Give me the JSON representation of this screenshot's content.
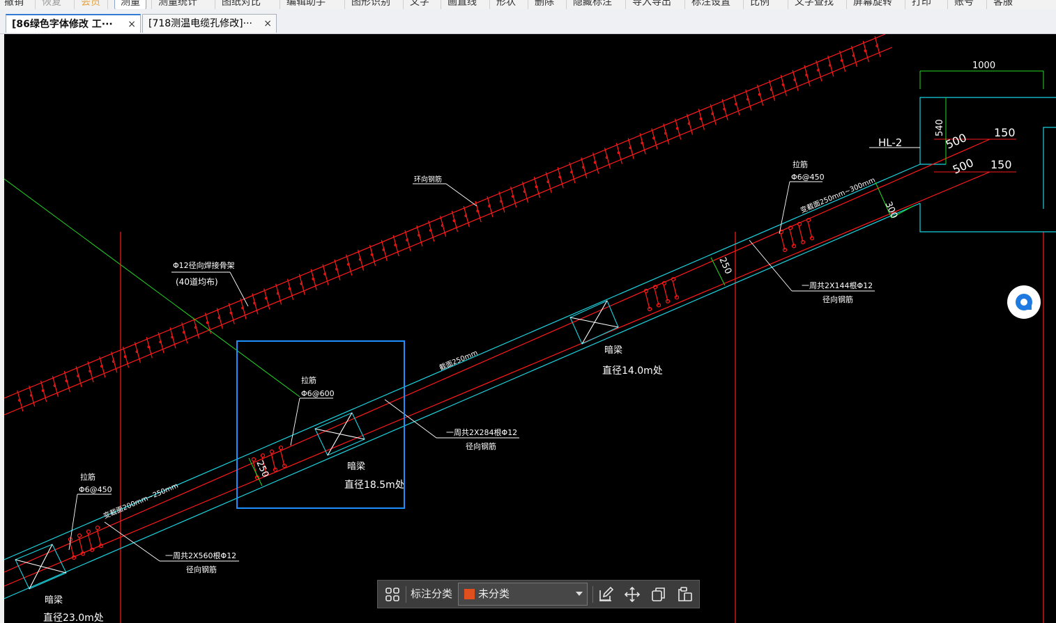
{
  "menu": [
    {
      "label": "撤销",
      "state": "normal"
    },
    {
      "label": "恢复",
      "state": "disabled"
    },
    {
      "label": "会员",
      "state": "vip"
    },
    {
      "label": "测量",
      "state": "active"
    },
    {
      "label": "测量统计",
      "state": "normal"
    },
    {
      "label": "图纸对比",
      "state": "normal"
    },
    {
      "label": "编辑助手",
      "state": "normal"
    },
    {
      "label": "图形识别",
      "state": "normal"
    },
    {
      "label": "文字",
      "state": "normal"
    },
    {
      "label": "画直线",
      "state": "normal"
    },
    {
      "label": "形状",
      "state": "normal"
    },
    {
      "label": "删除",
      "state": "normal"
    },
    {
      "label": "隐藏标注",
      "state": "normal"
    },
    {
      "label": "导入导出",
      "state": "normal"
    },
    {
      "label": "标注设置",
      "state": "normal"
    },
    {
      "label": "比例",
      "state": "normal"
    },
    {
      "label": "文字查找",
      "state": "normal"
    },
    {
      "label": "屏幕旋转",
      "state": "normal"
    },
    {
      "label": "打印",
      "state": "normal"
    },
    {
      "label": "账号",
      "state": "normal"
    },
    {
      "label": "客服",
      "state": "normal"
    }
  ],
  "tabs": [
    {
      "label": "[86绿色字体修改 工···",
      "active": true,
      "close": "×"
    },
    {
      "label": "[718测温电缆孔修改]···",
      "active": false,
      "close": "×"
    }
  ],
  "drawing": {
    "dims": {
      "d1000": "1000",
      "d540": "540",
      "d500a": "500",
      "d150a": "150",
      "d500b": "500",
      "d150b": "150",
      "d300": "300",
      "d250a": "250",
      "d250b": "250"
    },
    "labels": {
      "hl2": "HL-2",
      "huanxiang": "环向钢筋",
      "phi12_main": "Φ12径向焊接骨架",
      "phi12_sub": "(40道均布)",
      "lajin_top": "拉筋",
      "lajin_top_spec": "Φ6@450",
      "biancuo_top": "变截面250mm~300mm",
      "yizhou144": "一周共2X144根Φ12",
      "yizhou144_sub": "径向钢筋",
      "anliang_14": "暗梁",
      "zhijing_14": "直径14.0m处",
      "jiemian250": "截面250mm",
      "lajin_mid": "拉筋",
      "lajin_mid_spec": "Φ6@600",
      "yizhou284": "一周共2X284根Φ12",
      "yizhou284_sub": "径向钢筋",
      "anliang_185": "暗梁",
      "zhijing_185": "直径18.5m处",
      "lajin_bot": "拉筋",
      "lajin_bot_spec": "Φ6@450",
      "biancuo_bot": "变截面200mm~250mm",
      "yizhou560": "一周共2X560根Φ12",
      "yizhou560_sub": "径向钢筋",
      "anliang_23": "暗梁",
      "zhijing_23": "直径23.0m处"
    }
  },
  "toolbar": {
    "grid_icon": "grid-icon",
    "category_label": "标注分类",
    "category_value": "未分类",
    "category_color": "#e0501f",
    "edit_icon": "edit-icon",
    "move_icon": "move-icon",
    "copy_icon": "copy-icon",
    "paste_icon": "paste-icon"
  },
  "colors": {
    "rebar": "#ff1a1a",
    "outline": "#19d4e0",
    "dim": "#22dd22",
    "text": "#ffffff",
    "selection": "#1e90ff",
    "accent": "#2f7bd6"
  }
}
